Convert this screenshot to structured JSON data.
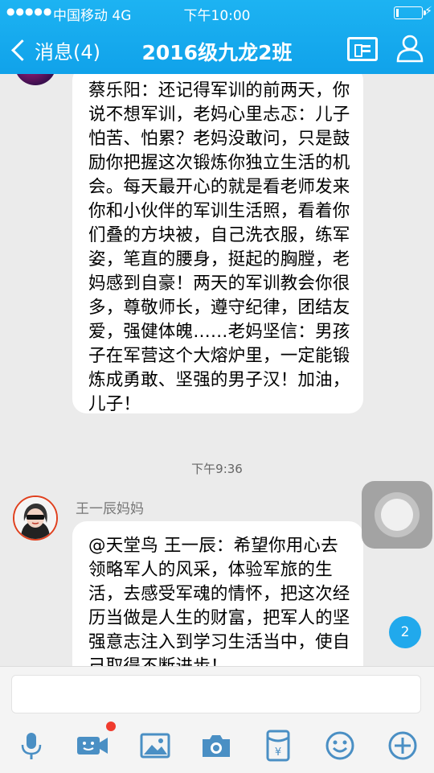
{
  "status_bar": {
    "signal": "●●●●●",
    "carrier": "中国移动  4G",
    "time": "下午10:00"
  },
  "nav": {
    "back_label": "消息(4)",
    "title": "2016级九龙2班"
  },
  "messages": [
    {
      "text": "蔡乐阳：还记得军训的前两天，你说不想军训，老妈心里忐忑：儿子怕苦、怕累？老妈没敢问，只是鼓励你把握这次锻炼你独立生活的机会。每天最开心的就是看老师发来你和小伙伴的军训生活照，看着你们叠的方块被，自己洗衣服，练军姿，笔直的腰身，挺起的胸膛，老妈感到自豪！两天的军训教会你很多，尊敬师长，遵守纪律，团结友爱，强健体魄……老妈坚信：男孩子在军营这个大熔炉里，一定能锻炼成勇敢、坚强的男子汉！加油，儿子！"
    },
    {
      "timestamp": "下午9:36",
      "sender": "王一辰妈妈",
      "text": "@天堂鸟 王一辰：希望你用心去领略军人的风采，体验军旅的生活，去感受军魂的情怀，把这次经历当做是人生的财富，把军人的坚强意志注入到学习生活当中，使自己取得不断进步！"
    }
  ],
  "unread_count": "2",
  "input": {
    "placeholder": ""
  },
  "toolbar": {
    "icons": [
      "microphone-icon",
      "video-icon",
      "image-icon",
      "camera-icon",
      "red-packet-icon",
      "emoji-icon",
      "plus-icon"
    ],
    "accent": "#4a8fc4"
  },
  "colors": {
    "topbar": "#12a8ee",
    "badge": "#21a9ec",
    "red_dot": "#f03b2e"
  }
}
